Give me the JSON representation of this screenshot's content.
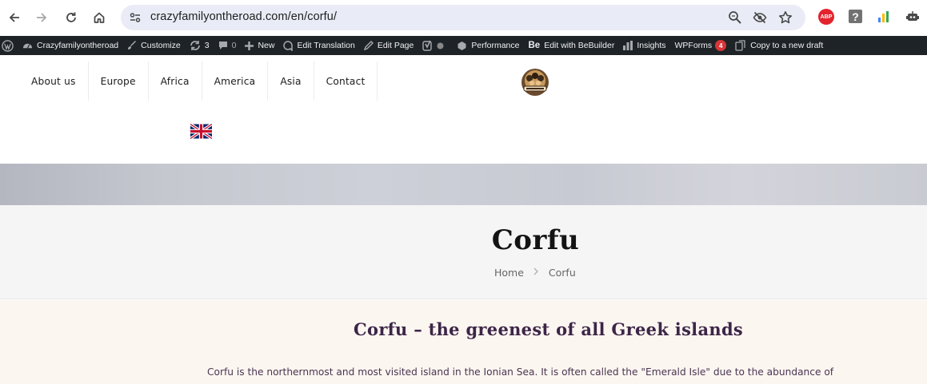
{
  "browser": {
    "url": "crazyfamilyontheroad.com/en/corfu/",
    "extensions": {
      "abp_label": "ABP",
      "help_label": "?"
    }
  },
  "admin_bar": {
    "site_name": "Crazyfamilyontheroad",
    "customize": "Customize",
    "updates_count": "3",
    "comments_count": "0",
    "new": "New",
    "edit_translation": "Edit Translation",
    "edit_page": "Edit Page",
    "performance": "Performance",
    "bebuilder_prefix": "Be",
    "edit_bebuilder": "Edit with BeBuilder",
    "insights": "Insights",
    "wpforms": "WPForms",
    "wpforms_count": "4",
    "copy_draft": "Copy to a new draft"
  },
  "nav": {
    "items": [
      "About us",
      "Europe",
      "Africa",
      "America",
      "Asia",
      "Contact"
    ]
  },
  "hero": {
    "title": "Corfu",
    "breadcrumb": {
      "home": "Home",
      "current": "Corfu"
    }
  },
  "content": {
    "heading": "Corfu – the greenest of all Greek islands",
    "paragraph": "Corfu is the northernmost and most visited island in the Ionian Sea. It is often called the \"Emerald Isle\" due to the abundance of"
  },
  "colors": {
    "admin_bar_bg": "#1d2327",
    "omnibox_bg": "#e9ecf6",
    "hero_title_bg": "#f5f5f5",
    "content_bg": "#fcf6f0",
    "heading_color": "#3d2548",
    "badge_red": "#d63638"
  }
}
